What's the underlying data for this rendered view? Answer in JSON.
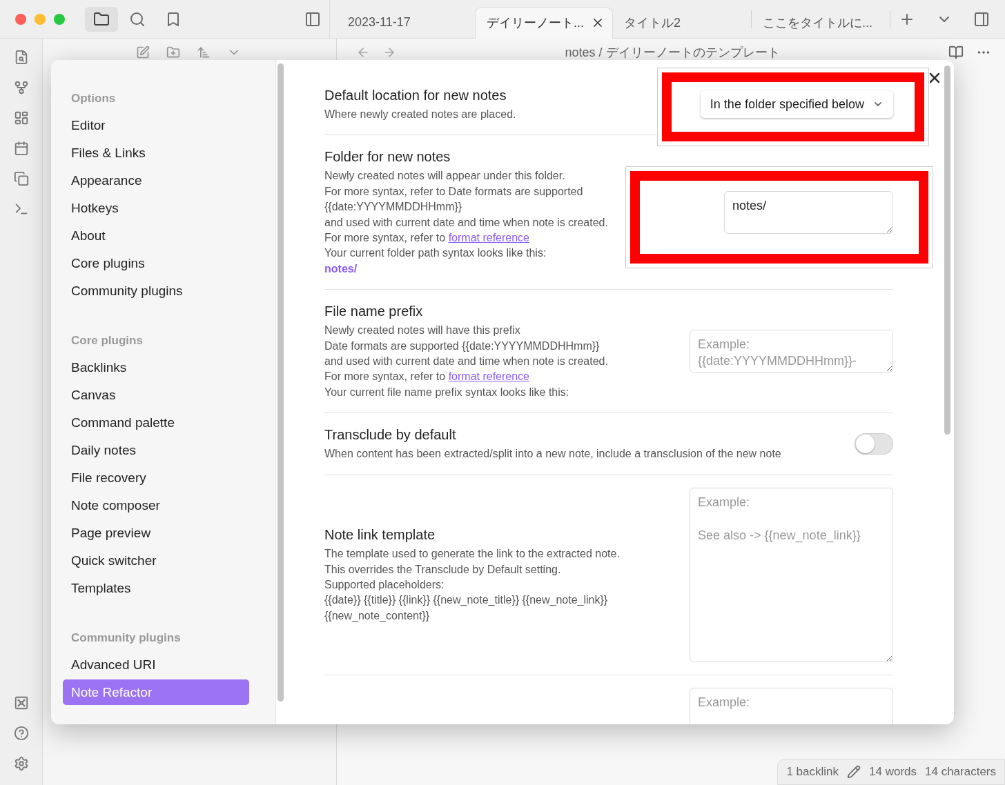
{
  "tabs": [
    {
      "label": "2023-11-17",
      "selected": false
    },
    {
      "label": "デイリーノート...",
      "selected": true
    },
    {
      "label": "タイトル2",
      "selected": false
    },
    {
      "label": "ここをタイトルに...",
      "selected": false
    }
  ],
  "breadcrumb": "notes / デイリーノートのテンプレート",
  "sidebar": [
    {
      "heading": "Options",
      "items": [
        {
          "label": "Editor",
          "selected": false
        },
        {
          "label": "Files & Links",
          "selected": false
        },
        {
          "label": "Appearance",
          "selected": false
        },
        {
          "label": "Hotkeys",
          "selected": false
        },
        {
          "label": "About",
          "selected": false
        },
        {
          "label": "Core plugins",
          "selected": false
        },
        {
          "label": "Community plugins",
          "selected": false
        }
      ]
    },
    {
      "heading": "Core plugins",
      "items": [
        {
          "label": "Backlinks",
          "selected": false
        },
        {
          "label": "Canvas",
          "selected": false
        },
        {
          "label": "Command palette",
          "selected": false
        },
        {
          "label": "Daily notes",
          "selected": false
        },
        {
          "label": "File recovery",
          "selected": false
        },
        {
          "label": "Note composer",
          "selected": false
        },
        {
          "label": "Page preview",
          "selected": false
        },
        {
          "label": "Quick switcher",
          "selected": false
        },
        {
          "label": "Templates",
          "selected": false
        }
      ]
    },
    {
      "heading": "Community plugins",
      "items": [
        {
          "label": "Advanced URI",
          "selected": false
        },
        {
          "label": "Note Refactor",
          "selected": true
        }
      ]
    }
  ],
  "settings": [
    {
      "name": "Default location for new notes",
      "description": [
        {
          "kind": "text",
          "text": "Where newly created notes are placed."
        }
      ],
      "control": {
        "kind": "dropdown",
        "value": "In the folder specified below",
        "highlighted": true
      }
    },
    {
      "name": "Folder for new notes",
      "description": [
        {
          "kind": "text",
          "text": "Newly created notes will appear under this folder."
        },
        {
          "kind": "text",
          "text": "For more syntax, refer to Date formats are supported"
        },
        {
          "kind": "text",
          "text": "{{date:YYYYMMDDHHmm}}"
        },
        {
          "kind": "text",
          "text": "and used with current date and time when note is created."
        },
        {
          "kind": "link",
          "text": "For more syntax, refer to",
          "link": "format reference"
        },
        {
          "kind": "text",
          "text": "Your current folder path syntax looks like this:"
        },
        {
          "kind": "code",
          "text": "notes/"
        }
      ],
      "control": {
        "kind": "textarea",
        "value": "notes/",
        "highlighted": true
      }
    },
    {
      "name": "File name prefix",
      "description": [
        {
          "kind": "text",
          "text": "Newly created notes will have this prefix"
        },
        {
          "kind": "text",
          "text": "Date formats are supported {{date:YYYYMMDDHHmm}}"
        },
        {
          "kind": "text",
          "text": "and used with current date and time when note is created."
        },
        {
          "kind": "link",
          "text": "For more syntax, refer to",
          "link": "format reference"
        },
        {
          "kind": "text",
          "text": "Your current file name prefix syntax looks like this:"
        }
      ],
      "control": {
        "kind": "textarea",
        "placeholder": "Example: {{date:YYYYMMDDHHmm}}-",
        "highlighted": false
      }
    },
    {
      "name": "Transclude by default",
      "description": [
        {
          "kind": "text",
          "text": "When content has been extracted/split into a new note, include a transclusion of the new note"
        }
      ],
      "control": {
        "kind": "toggle",
        "on": false,
        "highlighted": false
      }
    },
    {
      "name": "Note link template",
      "description": [
        {
          "kind": "text",
          "text": "The template used to generate the link to the extracted note."
        },
        {
          "kind": "text",
          "text": "This overrides the Transclude by Default setting."
        },
        {
          "kind": "text",
          "text": "Supported placeholders:"
        },
        {
          "kind": "text",
          "text": "{{date}} {{title}} {{link}} {{new_note_title}} {{new_note_link}} {{new_note_content}}"
        }
      ],
      "control": {
        "kind": "large-textarea",
        "placeholder": "Example:\n\nSee also -> {{new_note_link}}",
        "highlighted": false
      }
    },
    {
      "control": {
        "kind": "textarea",
        "placeholder": "Example:",
        "highlighted": false
      }
    }
  ],
  "status_bar": [
    "1 backlink",
    "14 words",
    "14 characters"
  ]
}
